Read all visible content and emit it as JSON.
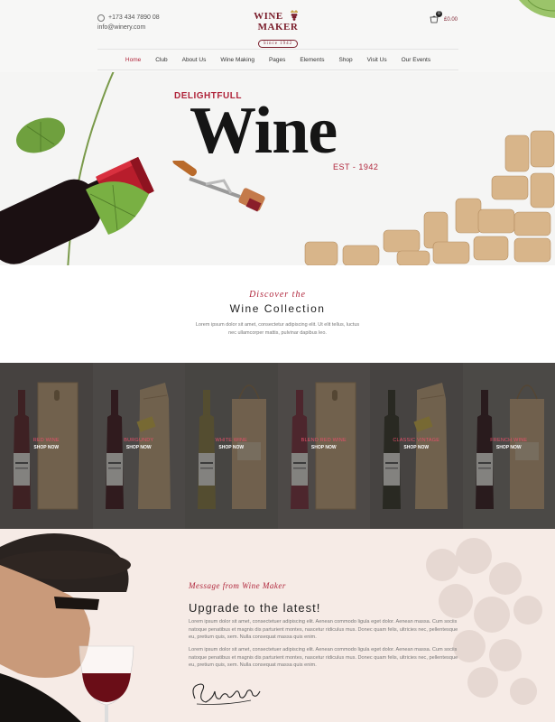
{
  "header": {
    "phone": "+173 434 7890 08",
    "email": "info@winery.com",
    "logo_left": "WINE",
    "logo_right": "MAKER",
    "logo_since": "Since 1942",
    "cart_total": "£0.00",
    "cart_count": "0"
  },
  "nav": {
    "items": [
      "Home",
      "Club",
      "About Us",
      "Wine Making",
      "Pages",
      "Elements",
      "Shop",
      "Visit Us",
      "Our Events"
    ],
    "active": "Home"
  },
  "hero": {
    "pretitle": "DELIGHTFULL",
    "title": "Wine",
    "est": "EST - 1942"
  },
  "collection": {
    "script": "Discover the",
    "title": "Wine Collection",
    "description": "Lorem ipsum dolor sit amet, consectetur adipiscing elit. Ut elit tellus, luctus nec ullamcorper mattis, pulvinar dapibus leo."
  },
  "products": [
    {
      "name": "RED WINE",
      "cta": "SHOP NOW",
      "wine_color": "#5a1a1d",
      "box": "wood"
    },
    {
      "name": "BURGUNDY",
      "cta": "SHOP NOW",
      "wine_color": "#3a0d12",
      "box": "paper"
    },
    {
      "name": "WHITE WINE",
      "cta": "SHOP NOW",
      "wine_color": "#8a7a3a",
      "box": "bag"
    },
    {
      "name": "BLEND RED WINE",
      "cta": "SHOP NOW",
      "wine_color": "#7a2533",
      "box": "wood"
    },
    {
      "name": "CLASSIC VINTAGE",
      "cta": "SHOP NOW",
      "wine_color": "#2a2a1c",
      "box": "paper"
    },
    {
      "name": "FRENCH WINE",
      "cta": "SHOP NOW",
      "wine_color": "#2a0d10",
      "box": "bag"
    }
  ],
  "message": {
    "script": "Message from Wine Maker",
    "title": "Upgrade to the latest!",
    "paragraph1": "Lorem ipsum dolor sit amet, consectetuer adipiscing elit. Aenean commodo ligula eget dolor. Aenean massa. Cum sociis natoque penatibus et magnis dis parturient montes, nascetur ridiculus mus. Donec quam felis, ultricies nec, pellentesque eu, pretium quis, sem. Nulla consequat massa quis enim.",
    "paragraph2": "Lorem ipsum dolor sit amet, consectetuer adipiscing elit. Aenean commodo ligula eget dolor. Aenean massa. Cum sociis natoque penatibus et magnis dis parturient montes, nascetur ridiculus mus. Donec quam felis, ultricies nec, pellentesque eu, pretium quis, sem. Nulla consequat massa quis enim."
  },
  "colors": {
    "accent": "#b0253b",
    "dark": "#151515",
    "message_bg": "#f6ebe6"
  }
}
